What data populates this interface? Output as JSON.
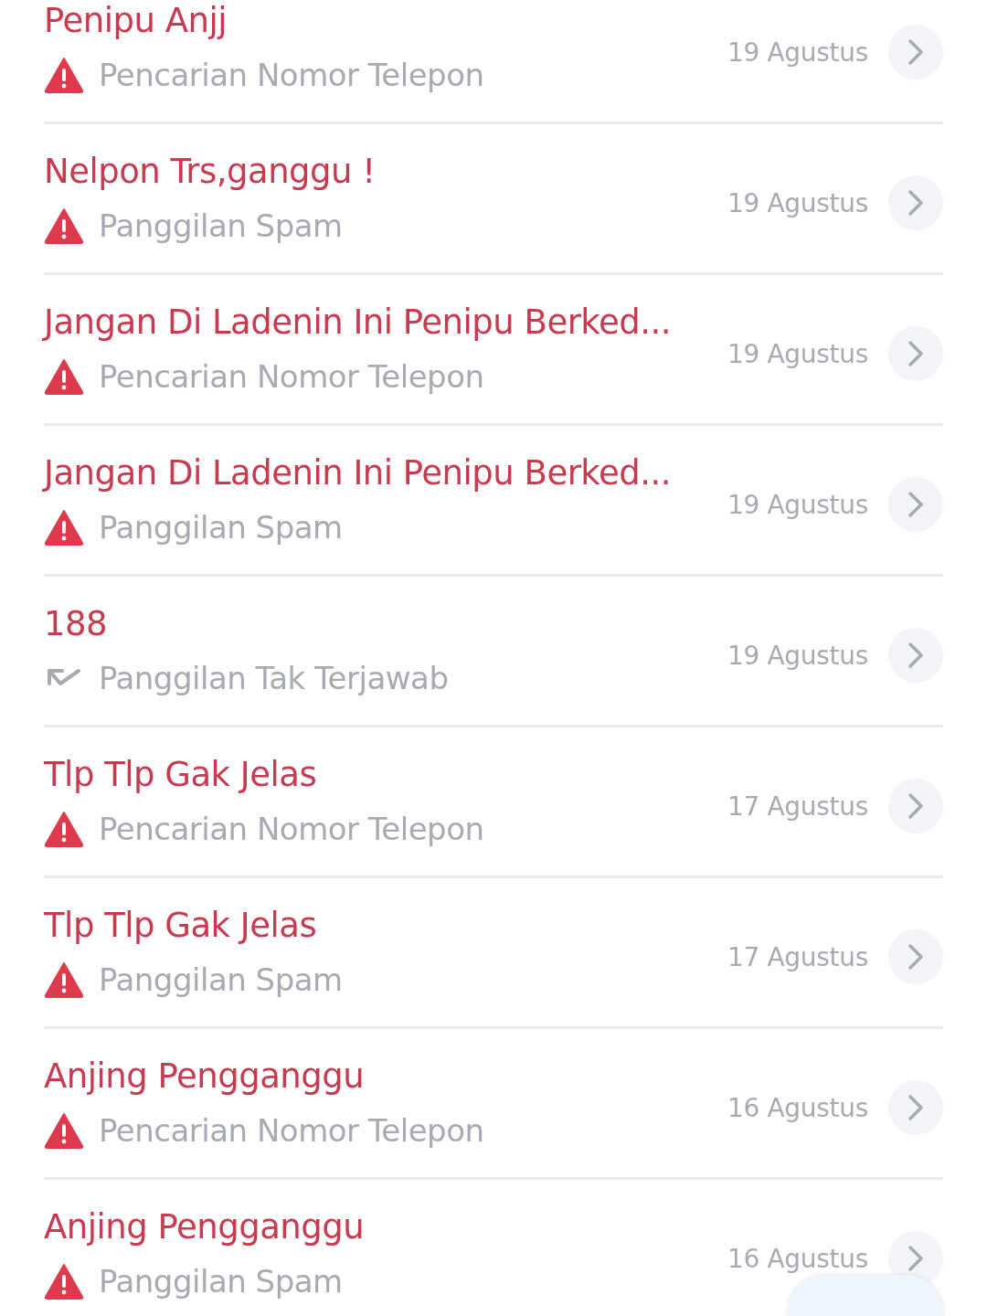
{
  "calls": [
    {
      "title": "Penipu Anjj",
      "kind": "warning",
      "label": "Pencarian Nomor Telepon",
      "date": "19 Agustus"
    },
    {
      "title": "Nelpon Trs,ganggu !",
      "kind": "warning",
      "label": "Panggilan Spam",
      "date": "19 Agustus"
    },
    {
      "title": "Jangan Di Ladenin Ini Penipu Berked...",
      "kind": "warning",
      "label": "Pencarian Nomor Telepon",
      "date": "19 Agustus"
    },
    {
      "title": "Jangan Di Ladenin Ini Penipu Berked...",
      "kind": "warning",
      "label": "Panggilan Spam",
      "date": "19 Agustus"
    },
    {
      "title": "188",
      "kind": "missed",
      "label": "Panggilan Tak Terjawab",
      "date": "19 Agustus"
    },
    {
      "title": "Tlp Tlp Gak Jelas",
      "kind": "warning",
      "label": "Pencarian Nomor Telepon",
      "date": "17 Agustus"
    },
    {
      "title": "Tlp Tlp Gak Jelas",
      "kind": "warning",
      "label": "Panggilan Spam",
      "date": "17 Agustus"
    },
    {
      "title": "Anjing Pengganggu",
      "kind": "warning",
      "label": "Pencarian Nomor Telepon",
      "date": "16 Agustus"
    },
    {
      "title": "Anjing Pengganggu",
      "kind": "warning",
      "label": "Panggilan Spam",
      "date": "16 Agustus"
    }
  ]
}
